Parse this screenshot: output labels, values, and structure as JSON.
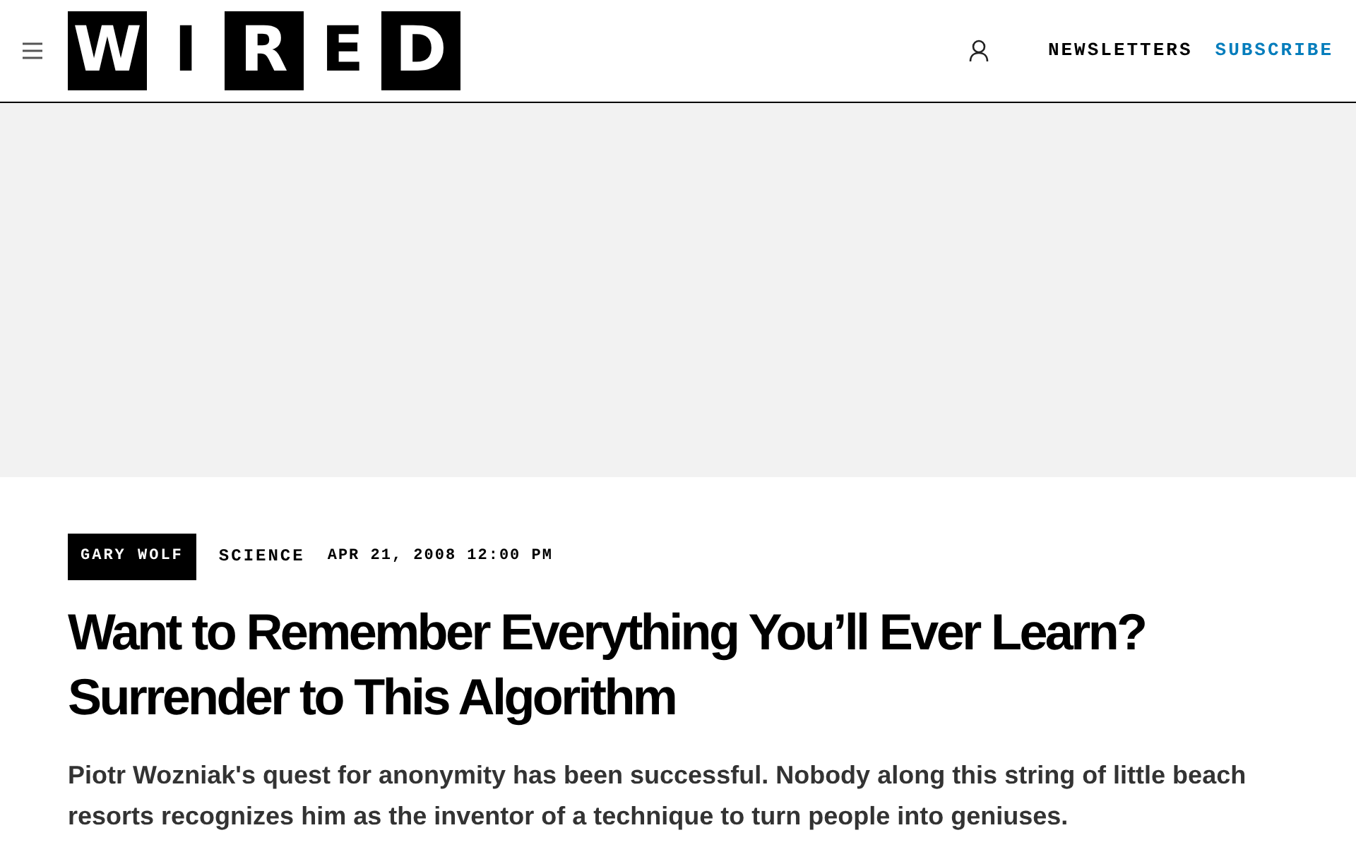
{
  "header": {
    "logo": [
      {
        "letter": "W",
        "filled": true
      },
      {
        "letter": "I",
        "filled": false
      },
      {
        "letter": "R",
        "filled": true
      },
      {
        "letter": "E",
        "filled": false
      },
      {
        "letter": "D",
        "filled": true
      }
    ],
    "nav": [
      {
        "label": "NEWSLETTERS",
        "kind": "link"
      },
      {
        "label": "SUBSCRIBE",
        "kind": "accent"
      }
    ]
  },
  "article": {
    "author": "GARY WOLF",
    "section": "SCIENCE",
    "date": "APR 21, 2008 12:00 PM",
    "headline": "Want to Remember Everything You’ll Ever Learn? Surrender to This Algorithm",
    "lede": "Piotr Wozniak's quest for anonymity has been successful. Nobody along this string of little beach resorts recognizes him as the inventor of a technique to turn people into geniuses."
  }
}
